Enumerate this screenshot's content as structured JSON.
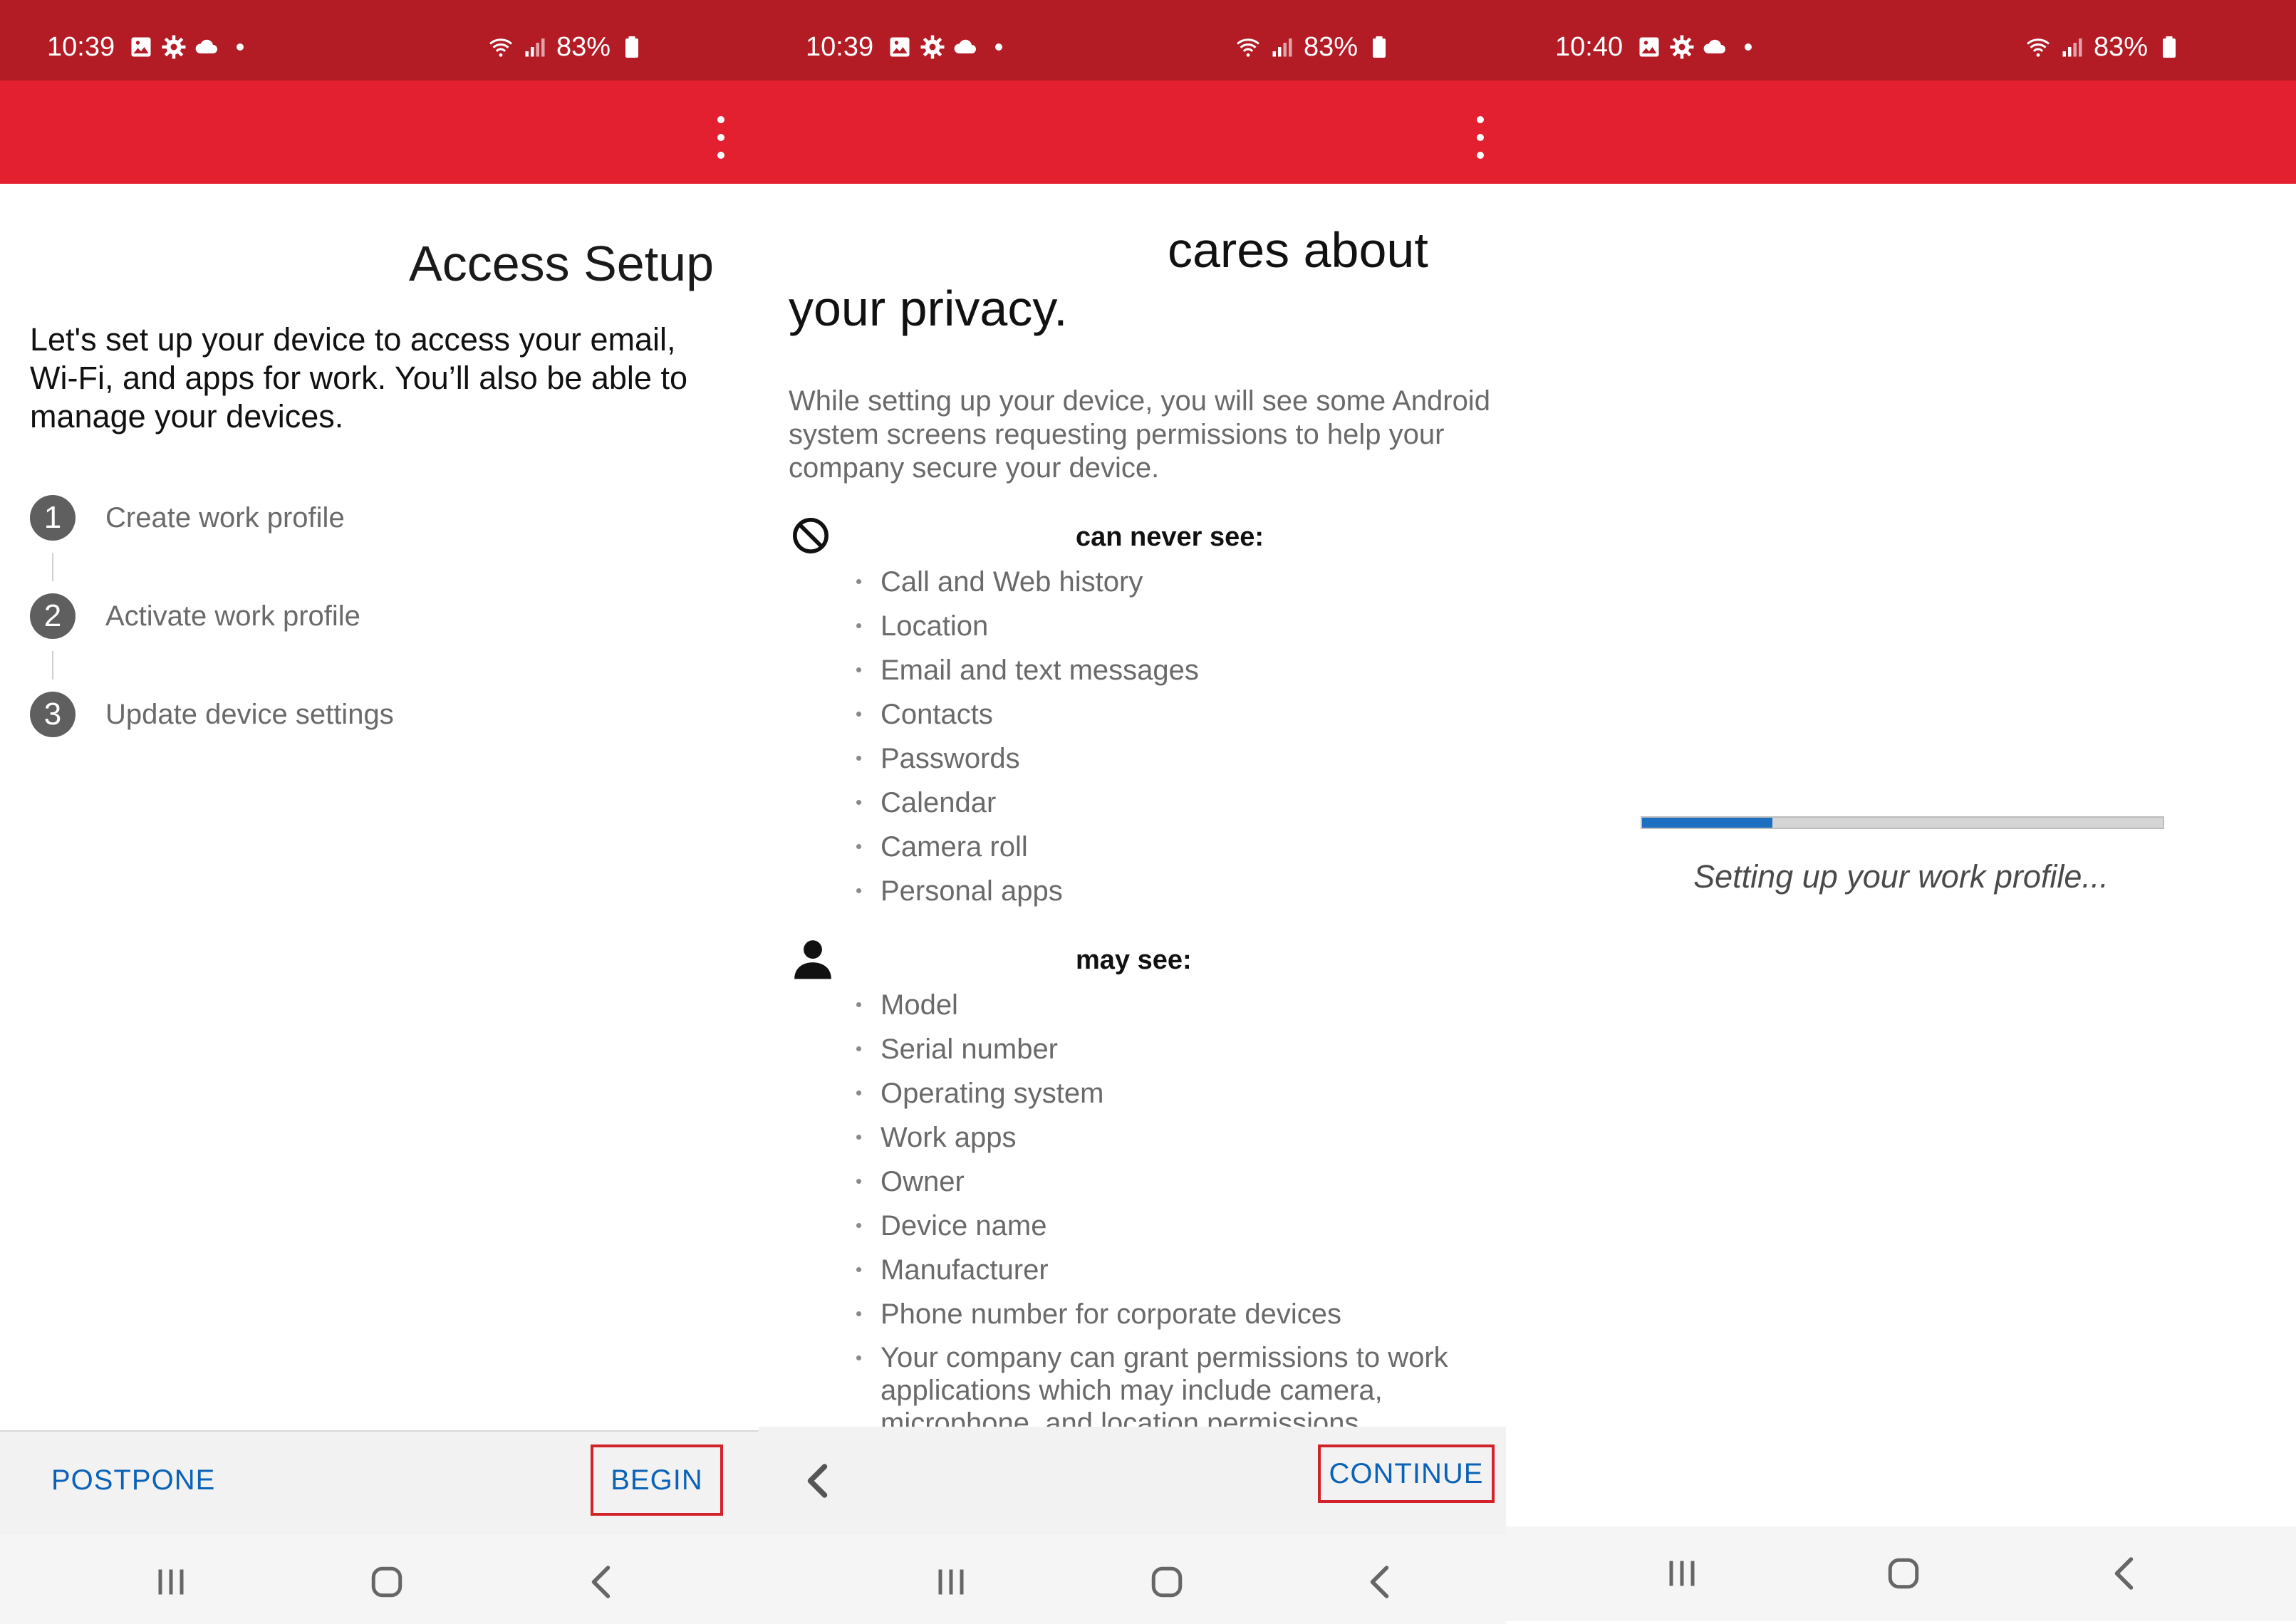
{
  "screen1": {
    "status": {
      "time": "10:39",
      "battery": "83%"
    },
    "title": "Access Setup",
    "description": "Let's set up your device to access your email, Wi-Fi, and apps for work. You’ll also be able to manage your devices.",
    "steps": [
      {
        "num": "1",
        "label": "Create work profile"
      },
      {
        "num": "2",
        "label": "Activate work profile"
      },
      {
        "num": "3",
        "label": "Update device settings"
      }
    ],
    "postpone": "POSTPONE",
    "begin": "BEGIN"
  },
  "screen2": {
    "status": {
      "time": "10:39",
      "battery": "83%"
    },
    "title_line1": "cares about",
    "title_line2": "your privacy.",
    "description": "While setting up your device, you will see some Android system screens requesting permissions to help your company secure your device.",
    "never_heading": "can never see:",
    "never_items": [
      "Call and Web history",
      "Location",
      "Email and text messages",
      "Contacts",
      "Passwords",
      "Calendar",
      "Camera roll",
      "Personal apps"
    ],
    "may_heading": "may see:",
    "may_items": [
      "Model",
      "Serial number",
      "Operating system",
      "Work apps",
      "Owner",
      "Device name",
      "Manufacturer",
      "Phone number for corporate devices",
      "Your company can grant permissions to work applications which may include camera, microphone, and location permissions."
    ],
    "continue": "CONTINUE"
  },
  "screen3": {
    "status": {
      "time": "10:40",
      "battery": "83%"
    },
    "progress_fraction": 0.25,
    "message": "Setting up your work profile..."
  },
  "colors": {
    "statusbar": "#b31b25",
    "appbar": "#e3202f",
    "link": "#0b63b8",
    "highlight_outline": "#d2232a",
    "progress": "#1d6fc1"
  },
  "icons": [
    "image-icon",
    "settings-gear-icon",
    "cloud-icon",
    "wifi-icon",
    "signal-icon",
    "battery-icon",
    "more-vert-icon",
    "block-icon",
    "person-icon",
    "recents-icon",
    "home-icon",
    "back-icon",
    "back-chevron-icon"
  ]
}
